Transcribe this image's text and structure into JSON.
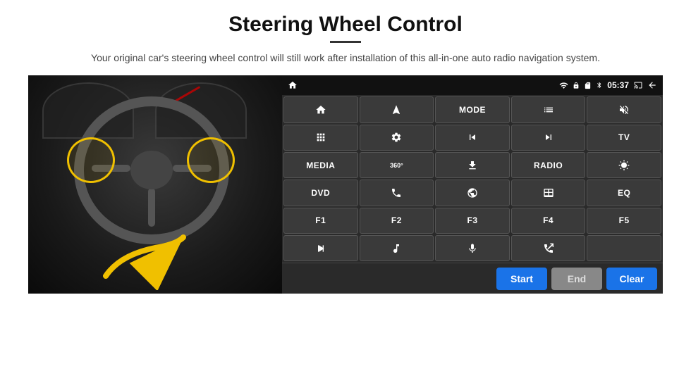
{
  "page": {
    "title": "Steering Wheel Control",
    "subtitle": "Your original car's steering wheel control will still work after installation of this all-in-one auto radio navigation system."
  },
  "status_bar": {
    "time": "05:37",
    "icons": [
      "wifi",
      "lock",
      "sd",
      "bluetooth",
      "cast",
      "back"
    ]
  },
  "buttons": [
    {
      "id": "b1",
      "type": "icon",
      "icon": "home",
      "label": "Home"
    },
    {
      "id": "b2",
      "type": "icon",
      "icon": "navigation",
      "label": "Nav"
    },
    {
      "id": "b3",
      "type": "text",
      "label": "MODE"
    },
    {
      "id": "b4",
      "type": "icon",
      "icon": "list",
      "label": "List"
    },
    {
      "id": "b5",
      "type": "icon",
      "icon": "mute",
      "label": "Mute"
    },
    {
      "id": "b6",
      "type": "icon",
      "icon": "dots",
      "label": "Apps"
    },
    {
      "id": "b7",
      "type": "icon",
      "icon": "settings",
      "label": "Settings"
    },
    {
      "id": "b8",
      "type": "icon",
      "icon": "prev",
      "label": "Prev"
    },
    {
      "id": "b9",
      "type": "icon",
      "icon": "next",
      "label": "Next"
    },
    {
      "id": "b10",
      "type": "text",
      "label": "TV"
    },
    {
      "id": "b11",
      "type": "text",
      "label": "MEDIA"
    },
    {
      "id": "b12",
      "type": "icon",
      "icon": "360",
      "label": "360"
    },
    {
      "id": "b13",
      "type": "icon",
      "icon": "eject",
      "label": "Eject"
    },
    {
      "id": "b14",
      "type": "text",
      "label": "RADIO"
    },
    {
      "id": "b15",
      "type": "icon",
      "icon": "brightness",
      "label": "Brightness"
    },
    {
      "id": "b16",
      "type": "text",
      "label": "DVD"
    },
    {
      "id": "b17",
      "type": "icon",
      "icon": "phone",
      "label": "Phone"
    },
    {
      "id": "b18",
      "type": "icon",
      "icon": "browse",
      "label": "Browse"
    },
    {
      "id": "b19",
      "type": "icon",
      "icon": "window",
      "label": "Window"
    },
    {
      "id": "b20",
      "type": "text",
      "label": "EQ"
    },
    {
      "id": "b21",
      "type": "text",
      "label": "F1"
    },
    {
      "id": "b22",
      "type": "text",
      "label": "F2"
    },
    {
      "id": "b23",
      "type": "text",
      "label": "F3"
    },
    {
      "id": "b24",
      "type": "text",
      "label": "F4"
    },
    {
      "id": "b25",
      "type": "text",
      "label": "F5"
    },
    {
      "id": "b26",
      "type": "icon",
      "icon": "playpause",
      "label": "Play/Pause"
    },
    {
      "id": "b27",
      "type": "icon",
      "icon": "music",
      "label": "Music"
    },
    {
      "id": "b28",
      "type": "icon",
      "icon": "mic",
      "label": "Mic"
    },
    {
      "id": "b29",
      "type": "icon",
      "icon": "call",
      "label": "Call"
    },
    {
      "id": "b30",
      "type": "empty",
      "label": ""
    }
  ],
  "bottom_buttons": {
    "start": "Start",
    "end": "End",
    "clear": "Clear"
  }
}
